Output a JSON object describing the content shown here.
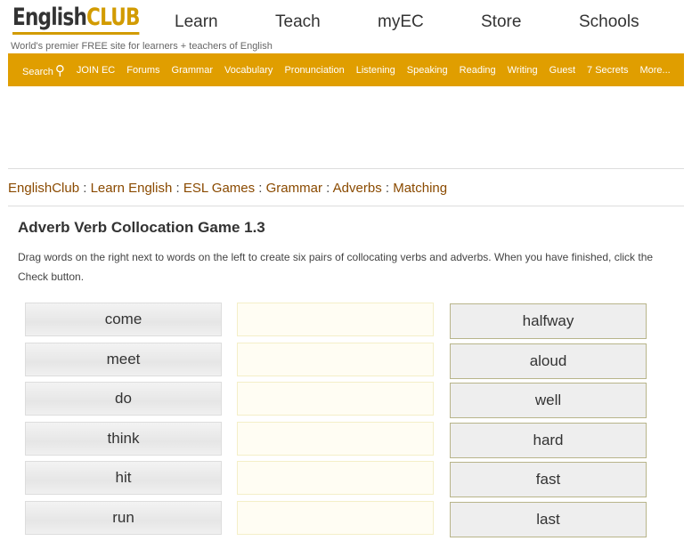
{
  "logo": {
    "english": "English",
    "club": "CLUB"
  },
  "tagline": "World's premier FREE site for learners + teachers of English",
  "topnav": [
    "Learn",
    "Teach",
    "myEC",
    "Store",
    "Schools"
  ],
  "nav": [
    "Search",
    "JOIN EC",
    "Forums",
    "Grammar",
    "Vocabulary",
    "Pronunciation",
    "Listening",
    "Speaking",
    "Reading",
    "Writing",
    "Guest",
    "7 Secrets",
    "More..."
  ],
  "breadcrumb": [
    "EnglishClub",
    "Learn English",
    "ESL Games",
    "Grammar",
    "Adverbs",
    "Matching"
  ],
  "sep": ":",
  "title": "Adverb Verb Collocation Game 1.3",
  "instructions": "Drag words on the right next to words on the left to create six pairs of collocating verbs and adverbs. When you have finished, click the Check button.",
  "verbs": [
    "come",
    "meet",
    "do",
    "think",
    "hit",
    "run"
  ],
  "adverbs": [
    "halfway",
    "aloud",
    "well",
    "hard",
    "fast",
    "last"
  ]
}
